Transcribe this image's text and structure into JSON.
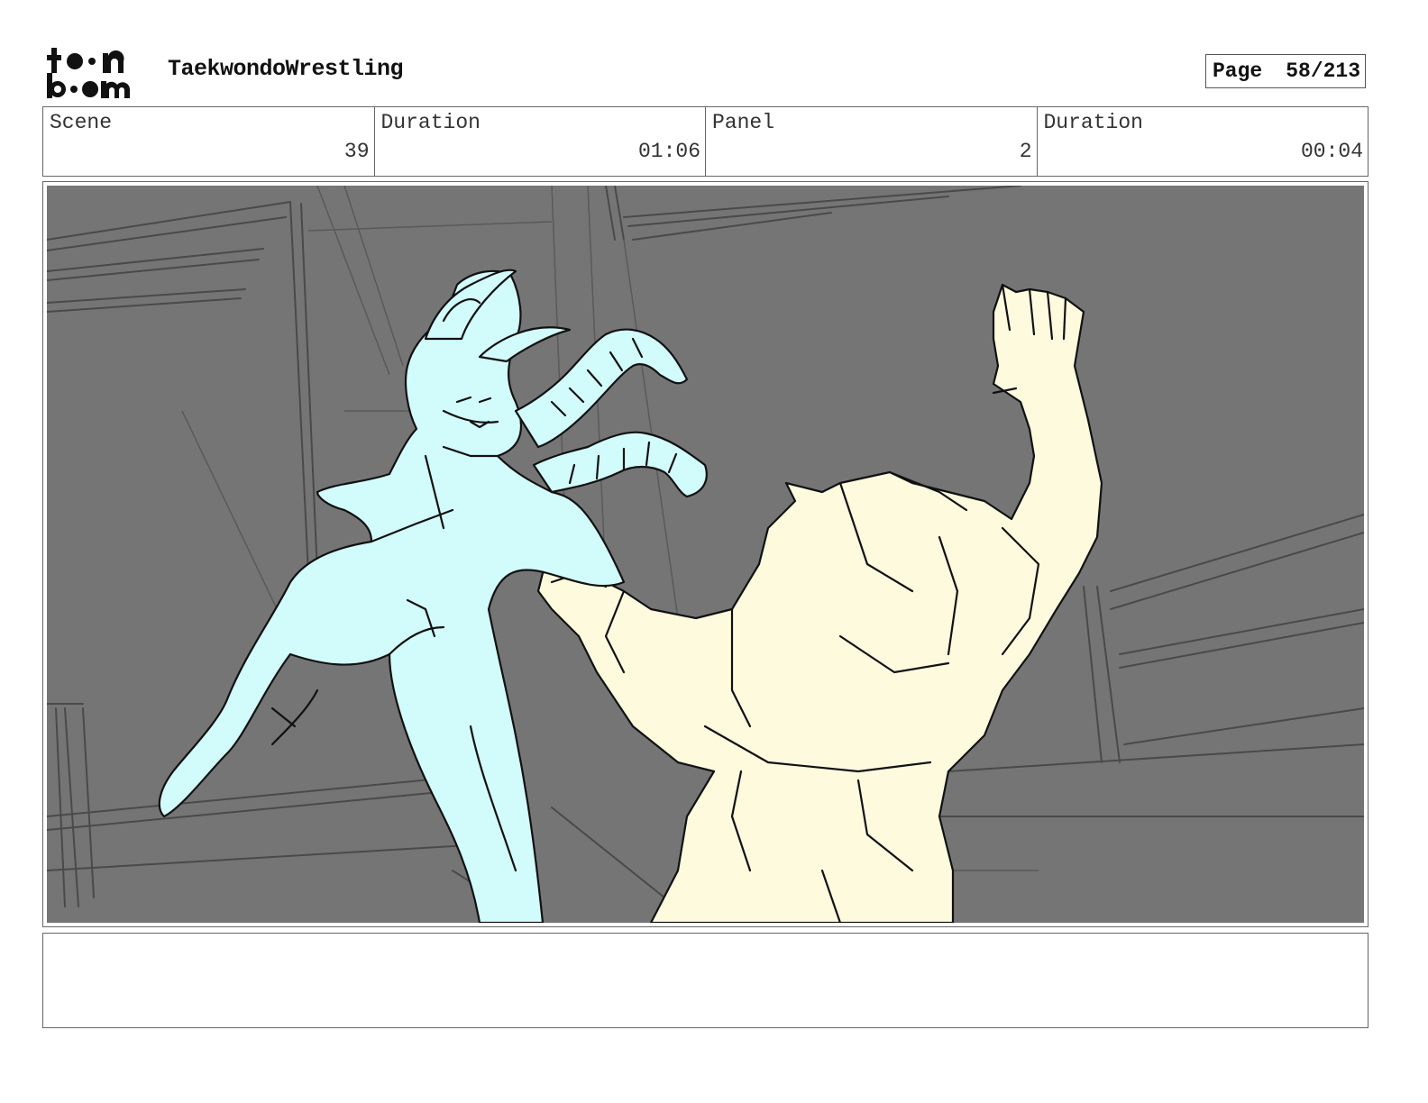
{
  "header": {
    "logo_icon": "toonboom-logo-icon",
    "project_title": "TaekwondoWrestling",
    "page_label": "Page",
    "page_number": "58/213"
  },
  "info": {
    "scene_label": "Scene",
    "scene_value": "39",
    "scene_duration_label": "Duration",
    "scene_duration_value": "01:06",
    "panel_label": "Panel",
    "panel_value": "2",
    "panel_duration_label": "Duration",
    "panel_duration_value": "00:04"
  },
  "panel": {
    "colors": {
      "background": "#757575",
      "fighter_left": "#d2fbfb",
      "fighter_right": "#fefade",
      "lineart": "#111111"
    }
  },
  "notes": {}
}
